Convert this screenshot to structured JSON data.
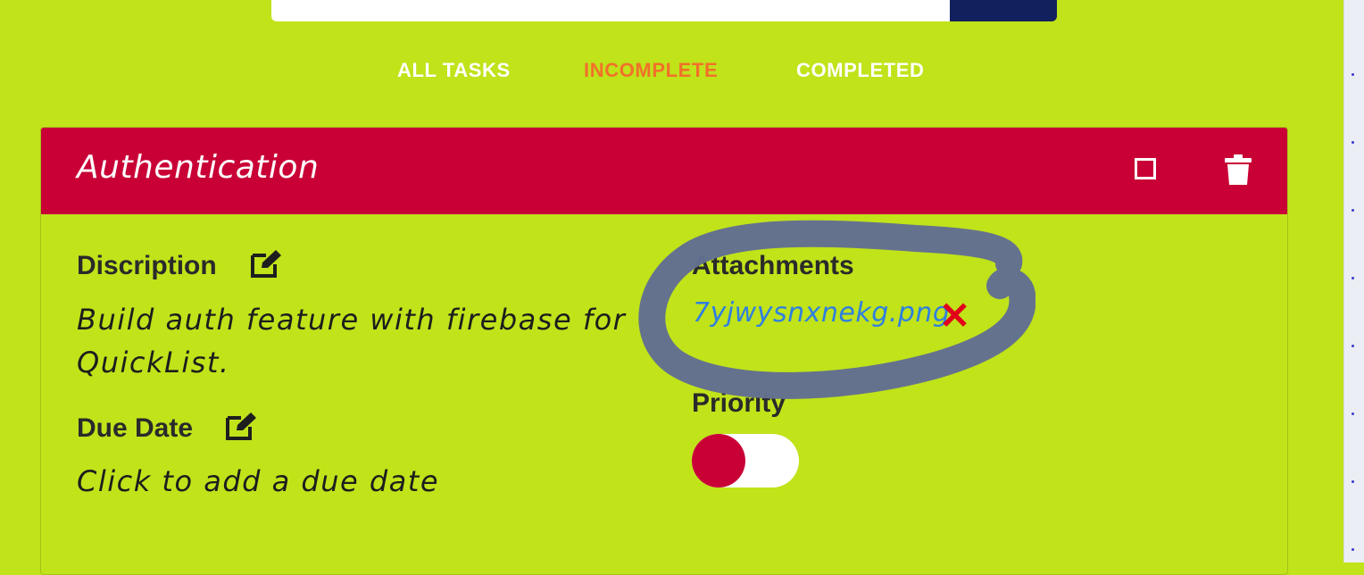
{
  "tabs": [
    {
      "label": "ALL TASKS"
    },
    {
      "label": "INCOMPLETE",
      "active": true
    },
    {
      "label": "COMPLETED"
    }
  ],
  "card": {
    "title": "Authentication",
    "description_label": "Discription",
    "description_text": "Build auth feature with firebase for QuickList.",
    "due_date_label": "Due Date",
    "due_date_text": "Click to add a due date",
    "attachments_label": "Attachments",
    "attachment_file": "7yjwysnxnekg.png",
    "remove_symbol": "✕",
    "priority_label": "Priority",
    "priority_on": false
  },
  "colors": {
    "background": "#c0e31a",
    "header": "#c90036",
    "active_tab": "#f2702a",
    "link": "#2f7fe0",
    "remove": "#e2001a",
    "scribble": "#636f90"
  },
  "icons": [
    "checkbox-icon",
    "trash-icon",
    "edit-icon",
    "close-icon"
  ]
}
